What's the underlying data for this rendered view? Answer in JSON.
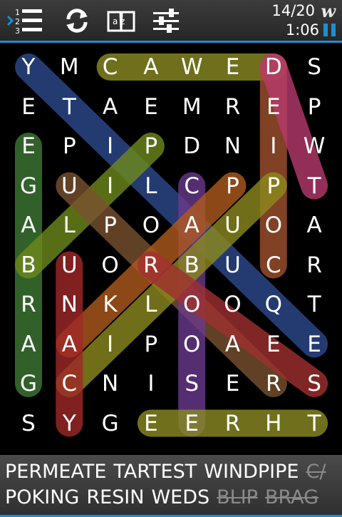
{
  "toolbar": {
    "icons": [
      "word-list-icon",
      "refresh-icon",
      "dictionary-icon",
      "settings-sliders-icon"
    ],
    "list_numbers": [
      "1",
      "2",
      "3"
    ],
    "dictionary_label": "a z",
    "progress": "14/20",
    "logo": "w",
    "timer": "1:06",
    "accent_color": "#1a8fd6"
  },
  "grid": [
    [
      "Y",
      "M",
      "C",
      "A",
      "W",
      "E",
      "D",
      "S"
    ],
    [
      "E",
      "T",
      "A",
      "E",
      "M",
      "R",
      "E",
      "P"
    ],
    [
      "E",
      "P",
      "I",
      "P",
      "D",
      "N",
      "I",
      "W"
    ],
    [
      "G",
      "U",
      "I",
      "L",
      "C",
      "P",
      "P",
      "T"
    ],
    [
      "A",
      "L",
      "P",
      "O",
      "A",
      "U",
      "O",
      "A"
    ],
    [
      "B",
      "U",
      "O",
      "R",
      "B",
      "U",
      "C",
      "R"
    ],
    [
      "R",
      "N",
      "K",
      "L",
      "O",
      "O",
      "Q",
      "T"
    ],
    [
      "A",
      "A",
      "I",
      "P",
      "O",
      "A",
      "E",
      "E"
    ],
    [
      "G",
      "C",
      "N",
      "I",
      "S",
      "E",
      "R",
      "S"
    ],
    [
      "S",
      "Y",
      "G",
      "E",
      "E",
      "R",
      "H",
      "T"
    ]
  ],
  "highlights": [
    {
      "from": [
        0,
        0
      ],
      "to": [
        7,
        7
      ],
      "color": "#2e4a8f"
    },
    {
      "from": [
        0,
        2
      ],
      "to": [
        0,
        6
      ],
      "color": "#8c8c24"
    },
    {
      "from": [
        0,
        6
      ],
      "to": [
        5,
        6
      ],
      "color": "#a0522d"
    },
    {
      "from": [
        0,
        6
      ],
      "to": [
        3,
        7
      ],
      "color": "#b83a6e"
    },
    {
      "from": [
        2,
        0
      ],
      "to": [
        8,
        0
      ],
      "color": "#3e7a34"
    },
    {
      "from": [
        2,
        3
      ],
      "to": [
        5,
        0
      ],
      "color": "#6f8a1c"
    },
    {
      "from": [
        3,
        1
      ],
      "to": [
        8,
        6
      ],
      "color": "#7a5230"
    },
    {
      "from": [
        3,
        4
      ],
      "to": [
        9,
        4
      ],
      "color": "#6a3a8c"
    },
    {
      "from": [
        3,
        6
      ],
      "to": [
        8,
        1
      ],
      "color": "#8d8a1e"
    },
    {
      "from": [
        3,
        5
      ],
      "to": [
        7,
        1
      ],
      "color": "#b05a1c"
    },
    {
      "from": [
        5,
        1
      ],
      "to": [
        9,
        1
      ],
      "color": "#a02828"
    },
    {
      "from": [
        5,
        3
      ],
      "to": [
        8,
        7
      ],
      "color": "#a03030"
    },
    {
      "from": [
        9,
        3
      ],
      "to": [
        9,
        7
      ],
      "color": "#8c8c24"
    }
  ],
  "words": {
    "row1": [
      {
        "text": "PERMEATE",
        "found": false
      },
      {
        "text": "TARTEST",
        "found": false
      },
      {
        "text": "WINDPIPE",
        "found": false
      },
      {
        "text": "C/",
        "found": true
      }
    ],
    "row2": [
      {
        "text": "POKING",
        "found": false
      },
      {
        "text": "RESIN",
        "found": false
      },
      {
        "text": "WEDS",
        "found": false
      },
      {
        "text": "BLIP",
        "found": true
      },
      {
        "text": "BRAG",
        "found": true
      }
    ]
  }
}
